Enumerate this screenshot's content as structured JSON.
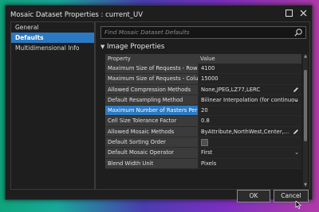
{
  "window": {
    "title": "Mosaic Dataset Properties : current_UV"
  },
  "nav": {
    "items": [
      {
        "label": "General"
      },
      {
        "label": "Defaults"
      },
      {
        "label": "Multidimensional Info"
      }
    ]
  },
  "search": {
    "placeholder": "Find Mosaic Dataset Defaults"
  },
  "section": {
    "title": "Image Properties"
  },
  "grid": {
    "headers": {
      "property": "Property",
      "value": "Value"
    },
    "rows": [
      {
        "property": "Maximum Size of Requests - Rows",
        "value": "4100"
      },
      {
        "property": "Maximum Size of Requests - Columns",
        "value": "15000"
      },
      {
        "property": "Allowed Compression Methods",
        "value": "None,JPEG,LZ77,LERC"
      },
      {
        "property": "Default Resampling Method",
        "value": "Bilinear Interpolation (for continuou"
      },
      {
        "property": "Maximum Number of Rasters Per M...",
        "value": "20"
      },
      {
        "property": "Cell Size Tolerance Factor",
        "value": "0.8"
      },
      {
        "property": "Allowed Mosaic Methods",
        "value": "ByAttribute,NorthWest,Center,..."
      },
      {
        "property": "Default Sorting Order",
        "value": ""
      },
      {
        "property": "Default Mosaic Operator",
        "value": "First"
      },
      {
        "property": "Blend Width Unit",
        "value": "Pixels"
      }
    ]
  },
  "buttons": {
    "ok": "OK",
    "cancel": "Cancel"
  },
  "colors": {
    "accent": "#2b79c2",
    "background": "#1e1e1e"
  }
}
